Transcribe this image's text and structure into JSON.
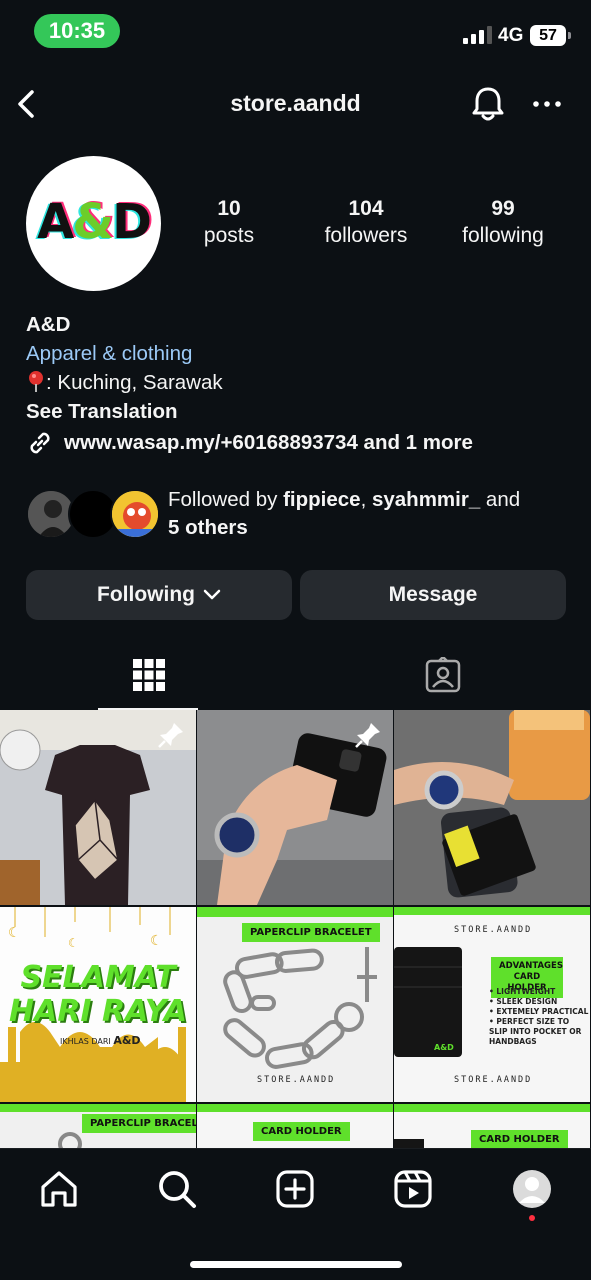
{
  "status": {
    "time": "10:35",
    "network": "4G",
    "battery": "57"
  },
  "header": {
    "username": "store.aandd"
  },
  "profile": {
    "avatar_text": "A&D",
    "posts_count": "10",
    "posts_label": "posts",
    "followers_count": "104",
    "followers_label": "followers",
    "following_count": "99",
    "following_label": "following",
    "name": "A&D",
    "category": "Apparel & clothing",
    "location": ": Kuching, Sarawak",
    "translate": "See Translation",
    "link": "www.wasap.my/+60168893734 and 1 more"
  },
  "followed_by": {
    "prefix": "Followed by ",
    "user1": "fippiece",
    "sep": ", ",
    "user2": "syahmmir_",
    "suffix": " and",
    "others": "5 others"
  },
  "actions": {
    "following_label": "Following",
    "message_label": "Message"
  },
  "grid": {
    "raya_line1": "SELAMAT",
    "raya_line2": "HARI RAYA",
    "raya_small": "IKHLAS DARI",
    "raya_brand": "A&D",
    "paperclip_label": "PAPERCLIP BRACELET",
    "store_name": "STORE.AANDD",
    "advantages_label": "ADVANTAGES CARD HOLDER",
    "adv_1": "• LIGHTWEIGHT",
    "adv_2": "• SLEEK DESIGN",
    "adv_3": "• EXTEMELY PRACTICAL",
    "adv_4": "• PERFECT SIZE TO SLIP INTO POCKET OR HANDBAGS",
    "brand_small": "A&D",
    "cardholder_label": "CARD HOLDER"
  },
  "colors": {
    "background": "#0c1014",
    "button": "#262a2f",
    "accent_green": "#5fe02b",
    "link_blue": "#9ccaf7"
  }
}
